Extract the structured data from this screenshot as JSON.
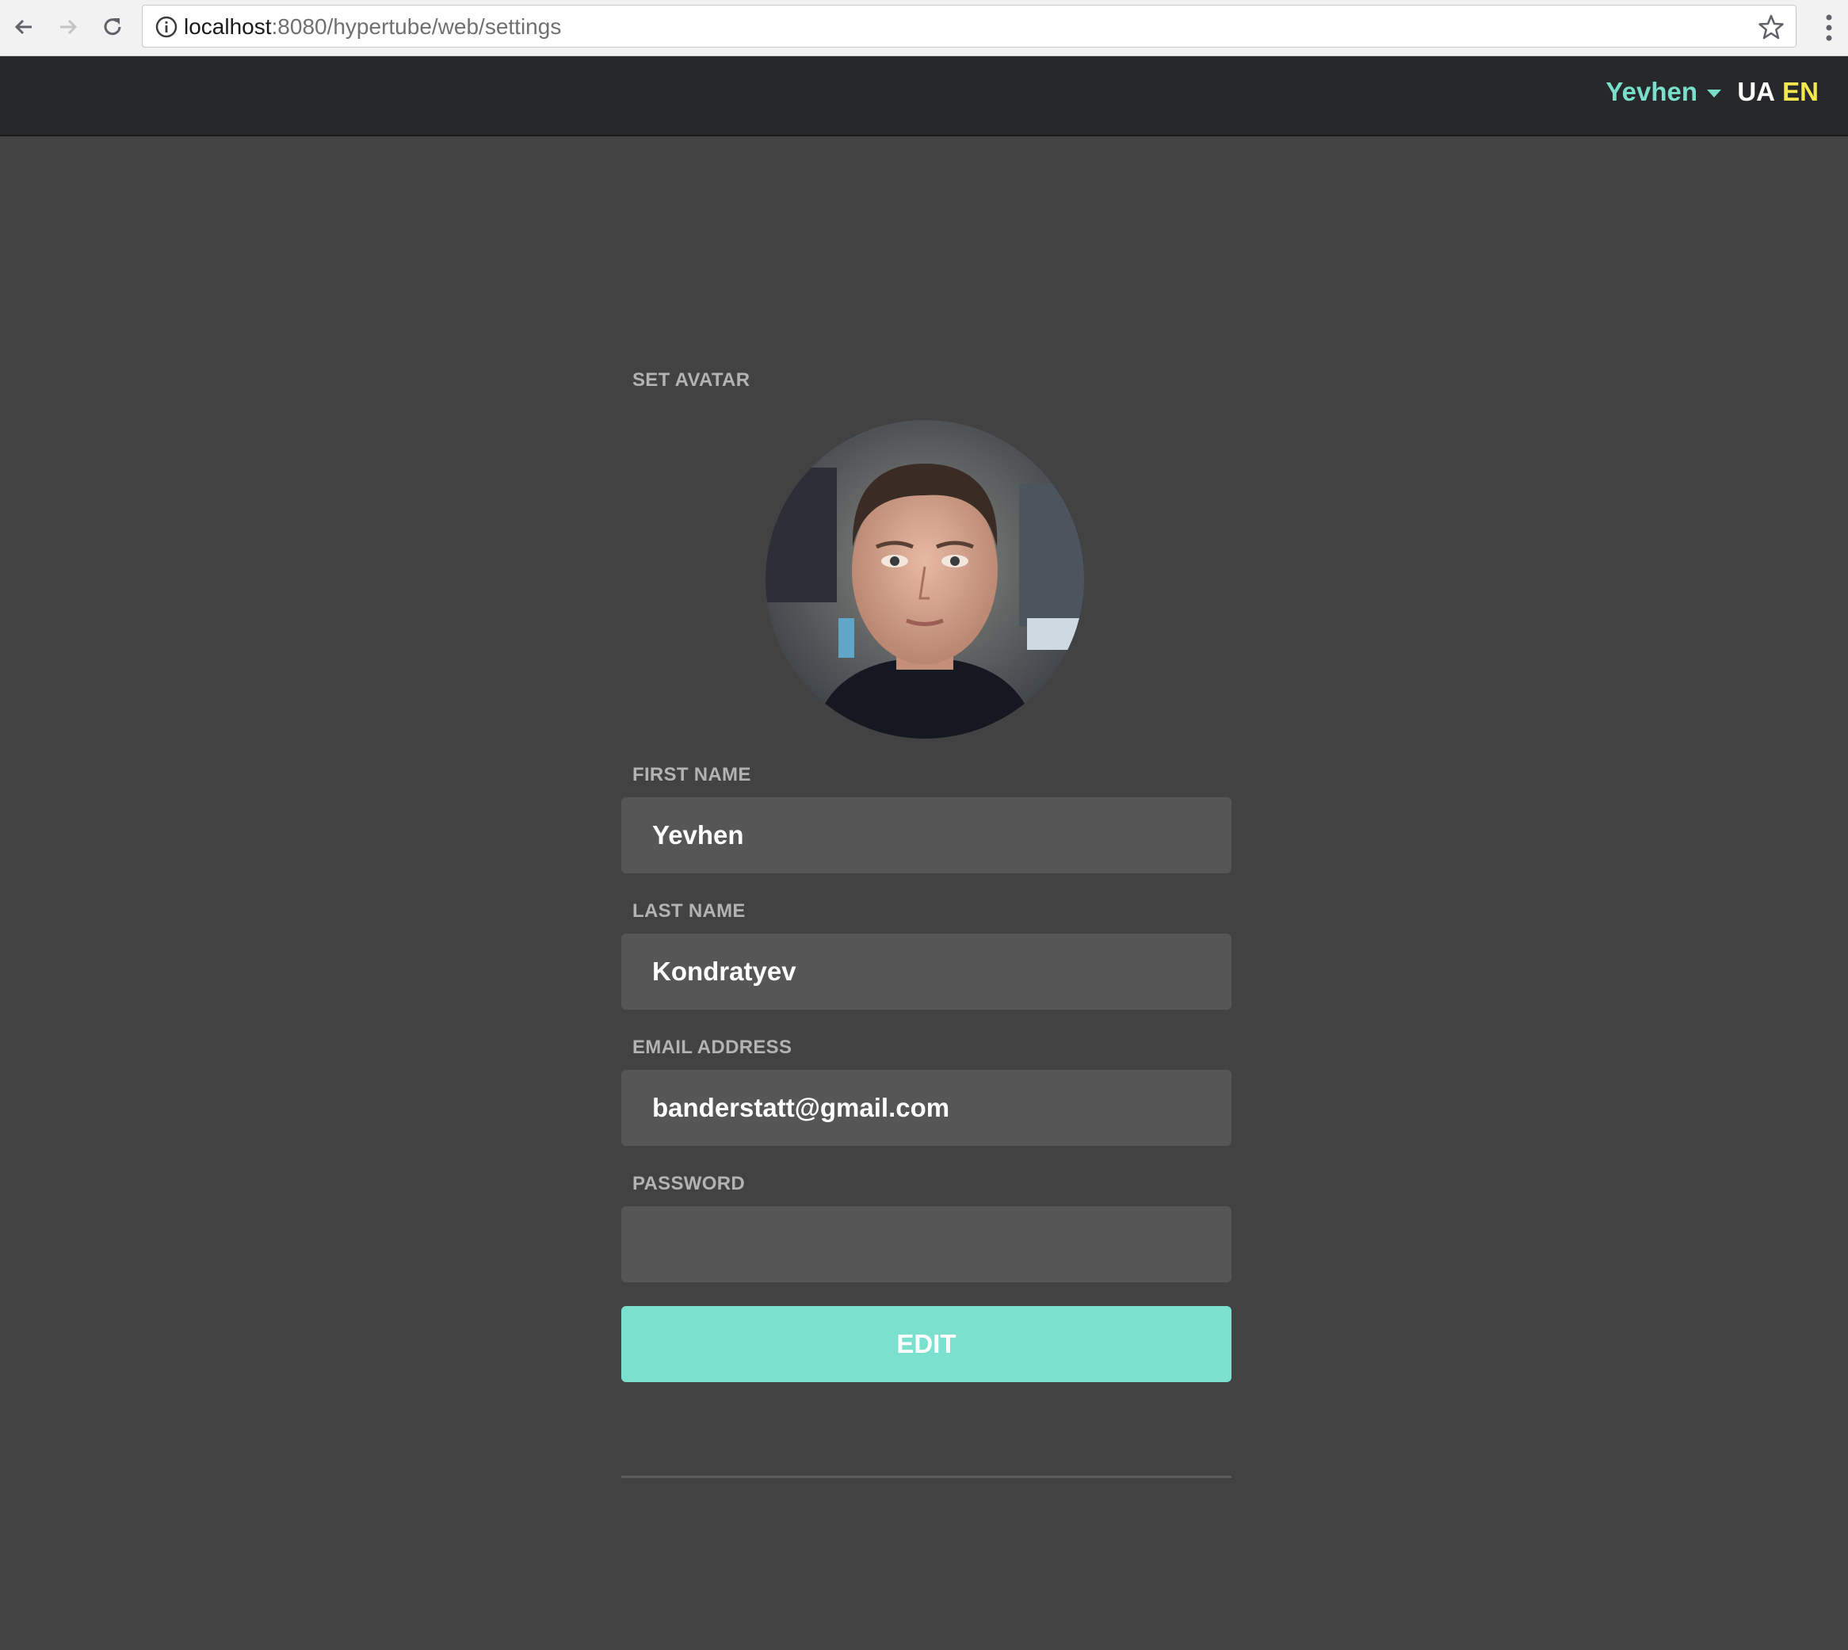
{
  "browser": {
    "url_host": "localhost",
    "url_path": ":8080/hypertube/web/settings"
  },
  "header": {
    "user_name": "Yevhen",
    "lang_ua": "UA",
    "lang_en": "EN",
    "colors": {
      "user": "#79dfcb",
      "lang_active": "#f3e84b",
      "lang_inactive": "#ffffff"
    }
  },
  "form": {
    "avatar_label": "SET AVATAR",
    "first_name_label": "FIRST NAME",
    "first_name_value": "Yevhen",
    "last_name_label": "LAST NAME",
    "last_name_value": "Kondratyev",
    "email_label": "EMAIL ADDRESS",
    "email_value": "banderstatt@gmail.com",
    "password_label": "PASSWORD",
    "password_value": "",
    "edit_button": "EDIT",
    "accent_color": "#7be0cd"
  }
}
